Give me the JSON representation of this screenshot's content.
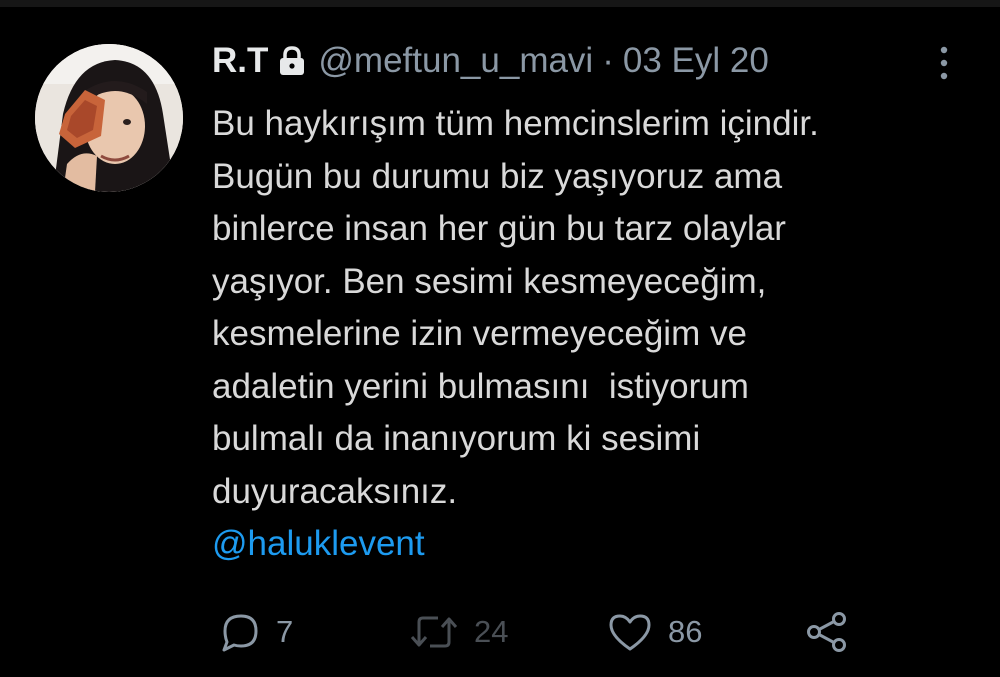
{
  "tweet": {
    "author_name": "R.T",
    "protected_icon": "lock-icon",
    "handle": "@meftun_u_mavi",
    "separator": "·",
    "date": "03 Eyl 20",
    "more_icon": "more-vertical-icon",
    "body_lines": [
      "Bu haykırışım tüm hemcinslerim içindir.",
      "Bugün bu durumu biz yaşıyoruz ama",
      "binlerce insan her gün bu tarz olaylar",
      "yaşıyor. Ben sesimi kesmeyeceğim,",
      "kesmelerine izin vermeyeceğim ve",
      "adaletin yerini bulmasını  istiyorum",
      "bulmalı da inanıyorum ki sesimi",
      "duyuracaksınız."
    ],
    "mention": "@haluklevent",
    "stats": {
      "replies": "7",
      "retweets": "24",
      "likes": "86"
    },
    "action_icons": [
      "reply-icon",
      "retweet-icon",
      "like-icon",
      "share-icon"
    ]
  },
  "colors": {
    "background": "#000000",
    "text": "#d9d9d9",
    "name": "#e7e9ea",
    "secondary": "#8b98a5",
    "mention": "#1d9bf0",
    "retweet_dimmed": "#4a4f55"
  }
}
